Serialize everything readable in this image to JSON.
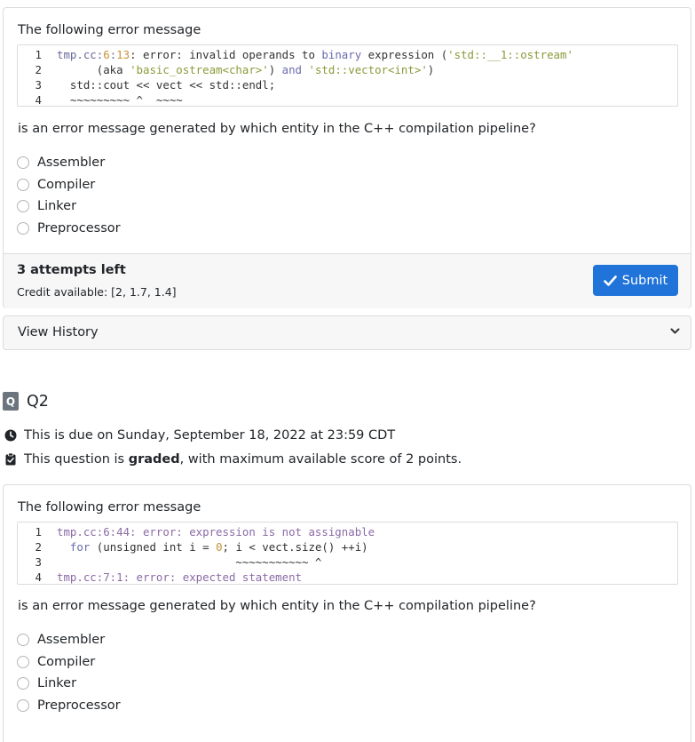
{
  "q1": {
    "prompt": "The following error message",
    "code_lines": [
      {
        "n": "1",
        "segs": [
          [
            "tmp.cc:",
            "path"
          ],
          [
            "6",
            "num"
          ],
          [
            ":",
            "path"
          ],
          [
            "13",
            "num"
          ],
          [
            ": error: invalid operands to ",
            "plain"
          ],
          [
            "binary",
            "kw"
          ],
          [
            " expression (",
            "plain"
          ],
          [
            "'std::__1::ostream'",
            "str"
          ]
        ]
      },
      {
        "n": "2",
        "segs": [
          [
            "      (aka ",
            "plain"
          ],
          [
            "'basic_ostream<char>'",
            "str"
          ],
          [
            ") ",
            "plain"
          ],
          [
            "and",
            "kw"
          ],
          [
            " ",
            "plain"
          ],
          [
            "'std::vector<int>'",
            "str"
          ],
          [
            ")",
            "plain"
          ]
        ]
      },
      {
        "n": "3",
        "segs": [
          [
            "  std::cout << vect << std::endl;",
            "plain"
          ]
        ]
      },
      {
        "n": "4",
        "segs": [
          [
            "  ~~~~~~~~~ ^  ~~~~",
            "plain"
          ]
        ]
      }
    ],
    "question": "is an error message generated by which entity in the C++ compilation pipeline?",
    "options": [
      "Assembler",
      "Compiler",
      "Linker",
      "Preprocessor"
    ],
    "attempts": "3 attempts left",
    "credit": "Credit available: [2, 1.7, 1.4]",
    "submit_label": "Submit"
  },
  "history": {
    "label": "View History"
  },
  "q2": {
    "badge": "Q",
    "title": "Q2",
    "due": "This is due on Sunday, September 18, 2022 at 23:59 CDT",
    "graded_pre": "This question is ",
    "graded_bold": "graded",
    "graded_post": ", with maximum available score of 2 points.",
    "prompt": "The following error message",
    "code_lines": [
      {
        "n": "1",
        "segs": [
          [
            "tmp.cc:6:44: error: expression is not assignable",
            "purple"
          ]
        ]
      },
      {
        "n": "2",
        "segs": [
          [
            "  ",
            "plain"
          ],
          [
            "for",
            "kw"
          ],
          [
            " (unsigned int i = ",
            "plain"
          ],
          [
            "0",
            "num"
          ],
          [
            "; i < vect.size() ++i)",
            "plain"
          ]
        ]
      },
      {
        "n": "3",
        "segs": [
          [
            "                           ~~~~~~~~~~~ ^",
            "plain"
          ]
        ]
      },
      {
        "n": "4",
        "segs": [
          [
            "tmp.cc:7:1: error: expected statement",
            "purple"
          ]
        ]
      }
    ],
    "question": "is an error message generated by which entity in the C++ compilation pipeline?",
    "options": [
      "Assembler",
      "Compiler",
      "Linker",
      "Preprocessor"
    ]
  },
  "icons": {
    "submit": "check-icon",
    "history": "chevron-down-icon",
    "due": "clock-icon",
    "graded": "clipboard-check-icon"
  },
  "colors": {
    "accent": "#1f73d9",
    "badge": "#6c757d"
  }
}
